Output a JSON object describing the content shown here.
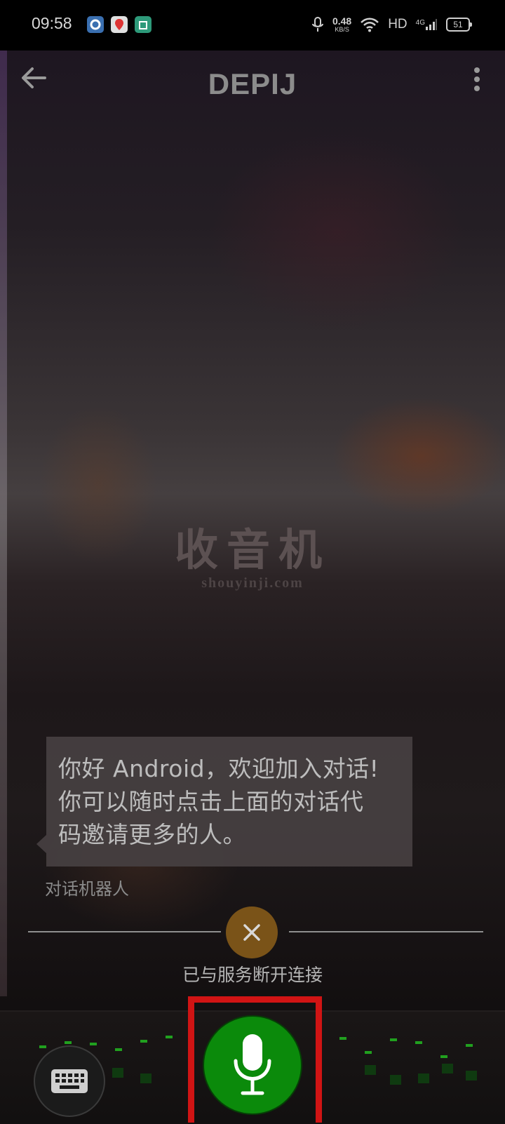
{
  "status_bar": {
    "time": "09:58",
    "net_speed_value": "0.48",
    "net_speed_unit": "KB/S",
    "hd_label": "HD",
    "network_label": "4G",
    "battery_level": "51"
  },
  "app_bar": {
    "title": "DEPIJ",
    "back_icon": "arrow-left-icon",
    "more_icon": "more-vert-icon"
  },
  "watermark": {
    "chinese": "收音机",
    "domain": "shouyinji.com"
  },
  "chat": {
    "message_lines": [
      "你好 Android，欢迎加入对话!",
      "你可以随时点击上面的对话代",
      "码邀请更多的人。"
    ],
    "sender": "对话机器人"
  },
  "connection": {
    "status_text": "已与服务断开连接",
    "icon": "close-icon",
    "accent": "#7a5318"
  },
  "controls": {
    "keyboard_icon": "keyboard-icon",
    "mic_icon": "microphone-icon",
    "mic_color": "#0b8a0b",
    "highlight_color": "#d01414"
  }
}
